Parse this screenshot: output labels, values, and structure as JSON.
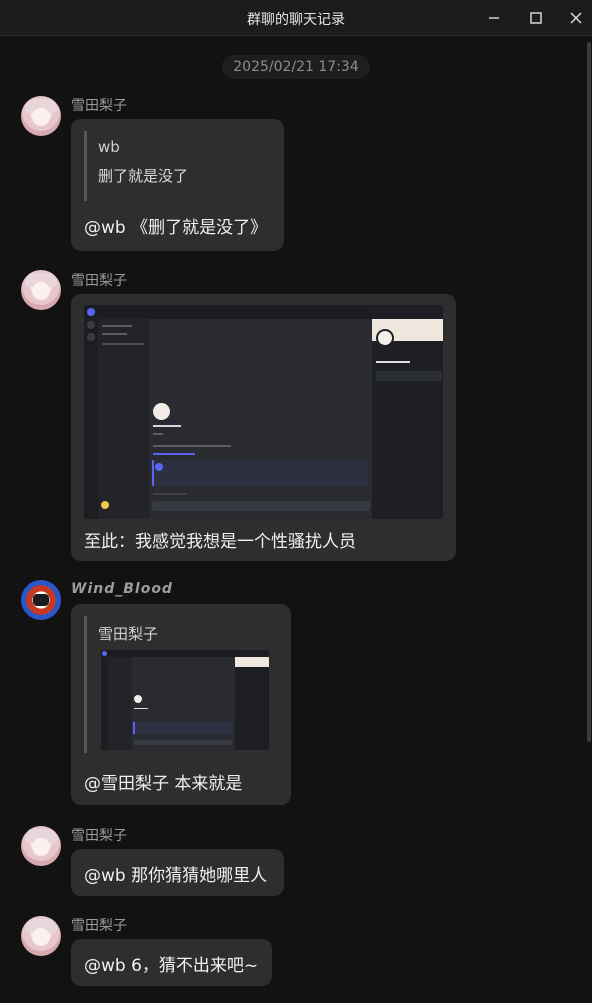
{
  "window": {
    "title": "群聊的聊天记录",
    "minimize_icon": "minimize-icon",
    "maximize_icon": "maximize-icon",
    "close_icon": "close-icon"
  },
  "timestamp": "2025/02/21 17:34",
  "messages": [
    {
      "sender": "雪田梨子",
      "avatar": "anime-girl-avatar",
      "quote": {
        "name": "wb",
        "text": "删了就是没了"
      },
      "text": "@wb 《删了就是没了》"
    },
    {
      "sender": "雪田梨子",
      "avatar": "anime-girl-avatar",
      "image": "discord-screenshot",
      "text": "至此：我感觉我想是一个性骚扰人员"
    },
    {
      "sender": "Wind_Blood",
      "avatar": "red-blue-character-avatar",
      "quote": {
        "name": "雪田梨子",
        "image": "discord-screenshot-thumbnail"
      },
      "text": "@雪田梨子 本来就是"
    },
    {
      "sender": "雪田梨子",
      "avatar": "anime-girl-avatar",
      "text": "@wb 那你猜猜她哪里人"
    },
    {
      "sender": "雪田梨子",
      "avatar": "anime-girl-avatar",
      "text": "@wb 6，猜不出来吧~"
    }
  ],
  "colors": {
    "background": "#121212",
    "bubble": "#2e2e2e",
    "titlebar": "#1c1c1c",
    "discord_accent": "#5865f2"
  }
}
